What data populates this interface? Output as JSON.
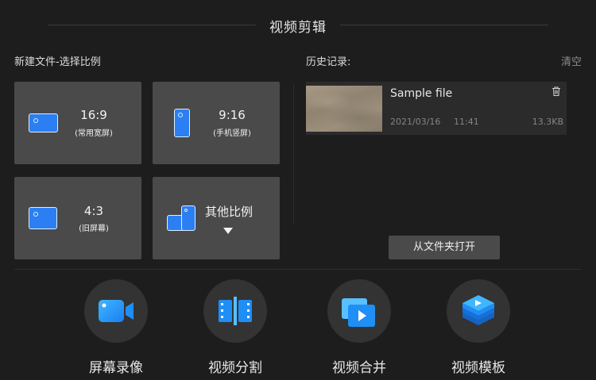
{
  "header": {
    "title": "视频剪辑"
  },
  "new_file": {
    "label": "新建文件-选择比例",
    "ratios": [
      {
        "main": "16:9",
        "sub": "(常用宽屏)"
      },
      {
        "main": "9:16",
        "sub": "(手机竖屏)"
      },
      {
        "main": "4:3",
        "sub": "(旧屏幕)"
      },
      {
        "main": "其他比例",
        "sub": ""
      }
    ]
  },
  "history": {
    "label": "历史记录:",
    "clear_label": "清空",
    "items": [
      {
        "name": "Sample file",
        "date": "2021/03/16",
        "time": "11:41",
        "size": "13.3KB"
      }
    ],
    "open_folder_label": "从文件夹打开"
  },
  "tools": [
    {
      "label": "屏幕录像",
      "icon": "video-camera-icon"
    },
    {
      "label": "视频分割",
      "icon": "film-split-icon"
    },
    {
      "label": "视频合并",
      "icon": "video-merge-icon"
    },
    {
      "label": "视频模板",
      "icon": "template-layers-icon"
    }
  ],
  "colors": {
    "accent": "#2b7ff2",
    "background": "#1d1d1d",
    "card": "#4a4a4a"
  }
}
